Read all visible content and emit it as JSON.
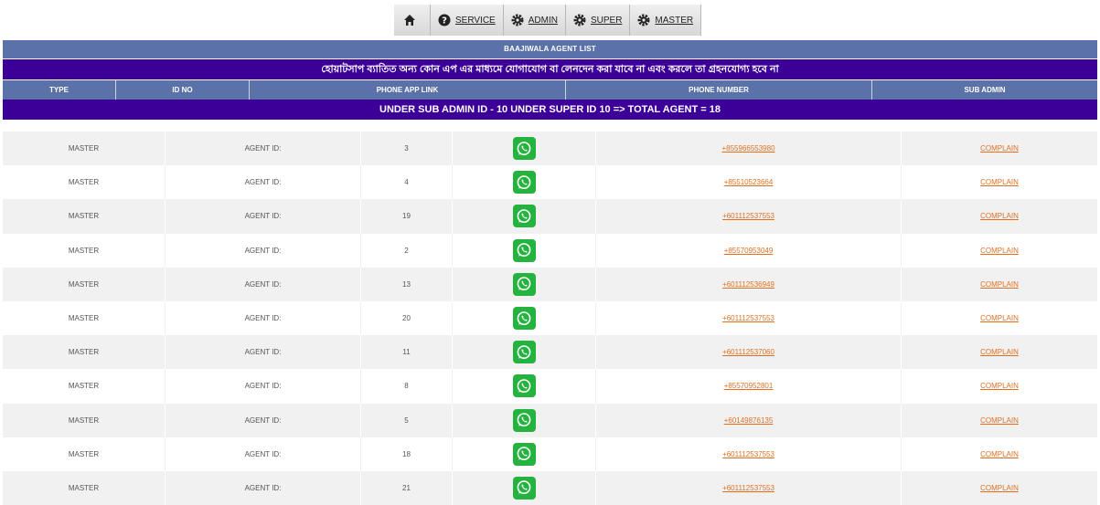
{
  "nav": {
    "items": [
      {
        "label": "",
        "icon": "home-icon"
      },
      {
        "label": "SERVICE",
        "icon": "question-circle-icon"
      },
      {
        "label": "ADMIN",
        "icon": "gear-icon"
      },
      {
        "label": "SUPER",
        "icon": "gear-icon"
      },
      {
        "label": "MASTER",
        "icon": "gear-icon"
      }
    ]
  },
  "title": "BAAJIWALA AGENT LIST",
  "notice": "হোয়াটসাপ ব্যাতিত অন্য কোন এপ এর মাধ্যমে যোগাযোগ বা লেনদেন করা যাবে না এবং করলে তা গ্রহনযোগ্য হবে না",
  "columns": [
    "TYPE",
    "ID NO",
    "PHONE APP LINK",
    "PHONE NUMBER",
    "SUB ADMIN"
  ],
  "summary": "UNDER SUB ADMIN ID - 10 UNDER SUPER ID 10 => TOTAL AGENT = 18",
  "colors": {
    "header_blue": "#5a72a8",
    "notice_purple": "#3c0099",
    "link_orange": "#e07020",
    "whatsapp_green": "#25b33f"
  },
  "agents": [
    {
      "type": "MASTER",
      "label": "AGENT ID:",
      "id": "3",
      "phone": "+855966553980",
      "complain": "COMPLAIN"
    },
    {
      "type": "MASTER",
      "label": "AGENT ID:",
      "id": "4",
      "phone": "+85510523664",
      "complain": "COMPLAIN"
    },
    {
      "type": "MASTER",
      "label": "AGENT ID:",
      "id": "19",
      "phone": "+601112537553",
      "complain": "COMPLAIN"
    },
    {
      "type": "MASTER",
      "label": "AGENT ID:",
      "id": "2",
      "phone": "+85570953049",
      "complain": "COMPLAIN"
    },
    {
      "type": "MASTER",
      "label": "AGENT ID:",
      "id": "13",
      "phone": "+601112536949",
      "complain": "COMPLAIN"
    },
    {
      "type": "MASTER",
      "label": "AGENT ID:",
      "id": "20",
      "phone": "+601112537553",
      "complain": "COMPLAIN"
    },
    {
      "type": "MASTER",
      "label": "AGENT ID:",
      "id": "11",
      "phone": "+601112537060",
      "complain": "COMPLAIN"
    },
    {
      "type": "MASTER",
      "label": "AGENT ID:",
      "id": "8",
      "phone": "+85570952801",
      "complain": "COMPLAIN"
    },
    {
      "type": "MASTER",
      "label": "AGENT ID:",
      "id": "5",
      "phone": "+60149876135",
      "complain": "COMPLAIN"
    },
    {
      "type": "MASTER",
      "label": "AGENT ID:",
      "id": "18",
      "phone": "+601112537553",
      "complain": "COMPLAIN"
    },
    {
      "type": "MASTER",
      "label": "AGENT ID:",
      "id": "21",
      "phone": "+601112537553",
      "complain": "COMPLAIN"
    }
  ]
}
